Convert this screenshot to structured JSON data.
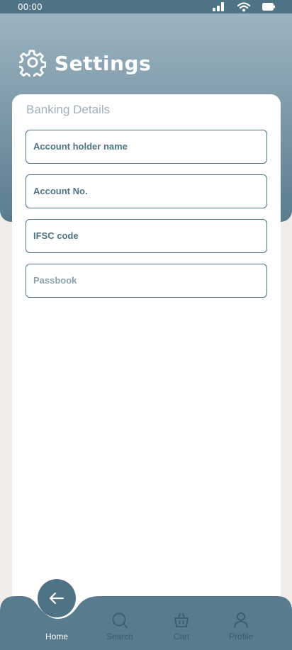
{
  "status_bar": {
    "time": "00:00",
    "icons": [
      "signal-icon",
      "wifi-icon",
      "battery-icon"
    ]
  },
  "header": {
    "icon": "gear-icon",
    "title": "Settings"
  },
  "form": {
    "section_title": "Banking Details",
    "fields": [
      {
        "placeholder": "Account holder name",
        "value": ""
      },
      {
        "placeholder": "Account No.",
        "value": ""
      },
      {
        "placeholder": "IFSC code",
        "value": ""
      },
      {
        "placeholder": "Passbook",
        "value": ""
      }
    ]
  },
  "fab": {
    "icon": "arrow-left-icon"
  },
  "nav": {
    "items": [
      {
        "label": "Home",
        "icon": "home-icon",
        "active": true
      },
      {
        "label": "Search",
        "icon": "search-icon",
        "active": false
      },
      {
        "label": "Cart",
        "icon": "basket-icon",
        "active": false
      },
      {
        "label": "Profile",
        "icon": "user-icon",
        "active": false
      }
    ]
  },
  "colors": {
    "primary": "#4e7385",
    "header_top": "#9db3bf",
    "background": "#f2ece9",
    "card": "#ffffff",
    "muted_text": "#9fb2bd"
  }
}
